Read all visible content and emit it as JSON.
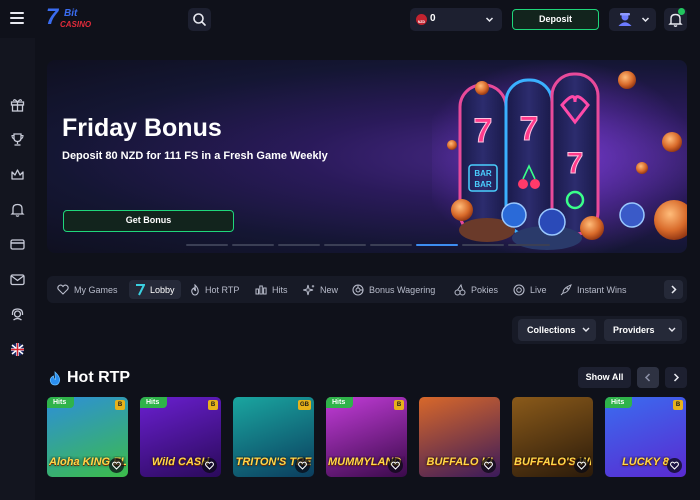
{
  "header": {
    "logo_seven": "7",
    "logo_bit": "Bit",
    "logo_casino": "CASINO",
    "balance_amount": "0",
    "balance_currency_badge": "NZD",
    "deposit_label": "Deposit"
  },
  "hero": {
    "title": "Friday Bonus",
    "subtitle": "Deposit 80 NZD for 111 FS in a Fresh Game Weekly",
    "button_label": "Get Bonus",
    "slide_count": 8,
    "active_slide": 6
  },
  "categories": [
    {
      "label": "My Games",
      "icon": "heart-gamepad-icon"
    },
    {
      "label": "Lobby",
      "icon": "lobby-seven-icon",
      "active": true
    },
    {
      "label": "Hot RTP",
      "icon": "flame-icon"
    },
    {
      "label": "Hits",
      "icon": "chart-bars-icon"
    },
    {
      "label": "New",
      "icon": "sparkle-icon"
    },
    {
      "label": "Bonus Wagering",
      "icon": "bonus-wheel-icon"
    },
    {
      "label": "Pokies",
      "icon": "cherries-icon"
    },
    {
      "label": "Live",
      "icon": "live-chip-icon"
    },
    {
      "label": "Instant Wins",
      "icon": "rocket-icon"
    }
  ],
  "filters": {
    "collections_label": "Collections",
    "providers_label": "Providers"
  },
  "section": {
    "title": "Hot RTP",
    "show_all_label": "Show All"
  },
  "games": [
    {
      "name": "Aloha King Elvis",
      "art_text": "Aloha KING ELVIS",
      "badge": "Hits",
      "provider": "B",
      "bg1": "#2d8fd8",
      "bg2": "#3cbc4a"
    },
    {
      "name": "Wild Cash",
      "art_text": "Wild CASH",
      "badge": "Hits",
      "provider": "B",
      "bg1": "#6a1fd0",
      "bg2": "#2a0a5a"
    },
    {
      "name": "Triton's Treasure",
      "art_text": "TRITON'S TRE",
      "badge": "",
      "provider": "GB",
      "bg1": "#1aa6a0",
      "bg2": "#0b3d5e"
    },
    {
      "name": "Mummyland Treasures",
      "art_text": "MUMMYLAND TREASURE",
      "badge": "Hits",
      "provider": "B",
      "bg1": "#c23cd8",
      "bg2": "#3a0a4a"
    },
    {
      "name": "Buffalo King",
      "art_text": "BUFFALO KI",
      "badge": "",
      "provider": "",
      "bg1": "#d8682a",
      "bg2": "#3a1a5a"
    },
    {
      "name": "Buffalo's Wealth",
      "art_text": "BUFFALO'S WEALTH",
      "badge": "",
      "provider": "",
      "bg1": "#8a5a1a",
      "bg2": "#2a1a0a"
    },
    {
      "name": "Lucky 8",
      "art_text": "LUCKY 8",
      "badge": "Hits",
      "provider": "B",
      "bg1": "#3a6cf0",
      "bg2": "#5a2ad0"
    }
  ],
  "colors": {
    "accent_green": "#1fd67b",
    "background": "#0f111a",
    "panel": "#171a26",
    "active_blue": "#3d8df0"
  }
}
